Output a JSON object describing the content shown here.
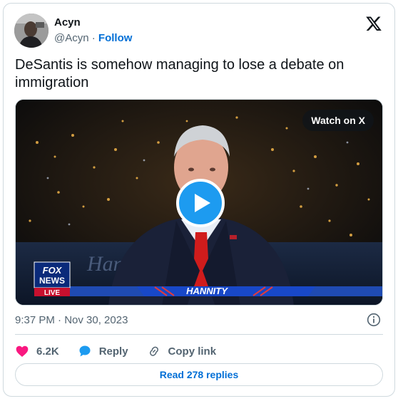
{
  "author": {
    "display_name": "Acyn",
    "handle": "@Acyn",
    "separator": "·",
    "follow_label": "Follow"
  },
  "tweet": {
    "text": "DeSantis is somehow managing to lose a debate on immigration"
  },
  "media": {
    "watch_label": "Watch on X",
    "network_logo": "FOX\nNEWS",
    "live_badge": "LIVE",
    "chyron": "HANNITY",
    "backdrop_text": "Hannity"
  },
  "meta": {
    "timestamp": "9:37 PM · Nov 30, 2023"
  },
  "actions": {
    "likes": "6.2K",
    "reply_label": "Reply",
    "copy_link_label": "Copy link"
  },
  "footer": {
    "read_replies_label": "Read 278 replies"
  },
  "colors": {
    "link_blue": "#006fd6",
    "play_blue": "#1d9bf0",
    "like_red": "#f91880",
    "muted": "#536471",
    "border": "#cfd9de"
  },
  "icons": [
    "x-logo-icon",
    "play-icon",
    "heart-icon",
    "reply-bubble-icon",
    "link-icon",
    "info-icon"
  ]
}
